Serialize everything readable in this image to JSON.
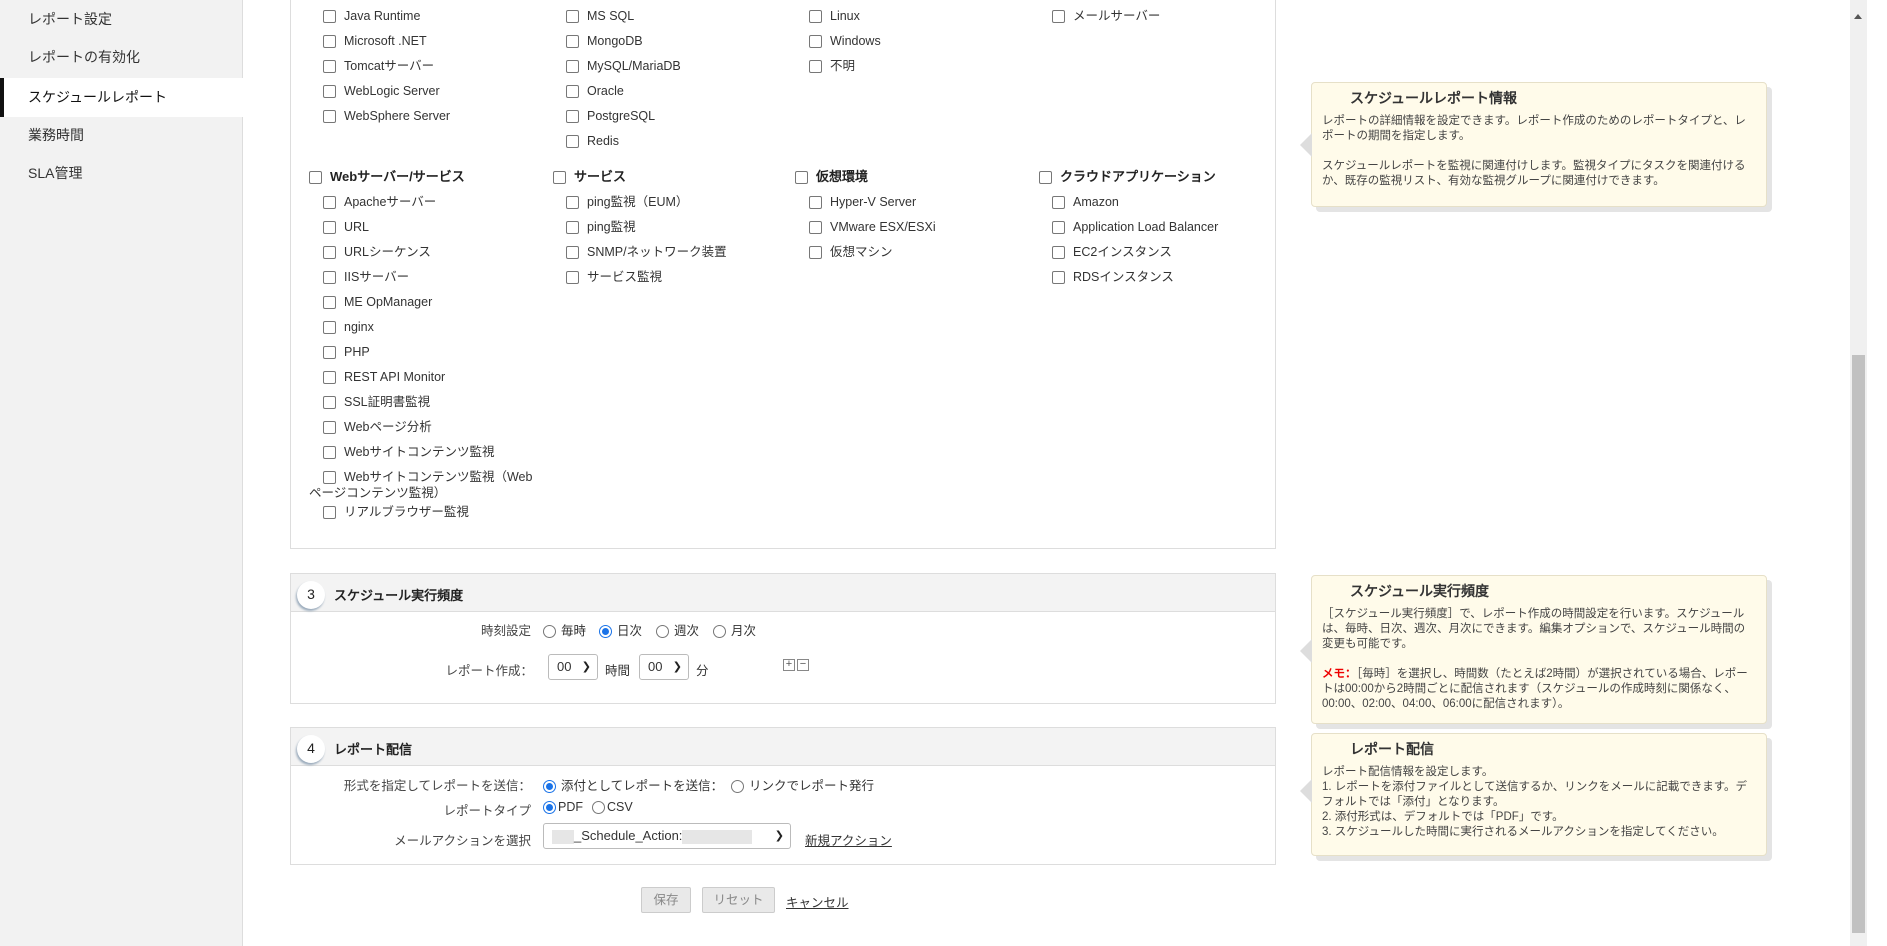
{
  "sidebar": {
    "items": [
      {
        "label": "レポート設定"
      },
      {
        "label": "レポートの有効化"
      },
      {
        "label": "スケジュールレポート",
        "active": true
      },
      {
        "label": "業務時間"
      },
      {
        "label": "SLA管理"
      }
    ]
  },
  "monitors": {
    "top_columns": [
      [
        "Java Runtime",
        "Microsoft .NET",
        "Tomcatサーバー",
        "WebLogic Server",
        "WebSphere Server"
      ],
      [
        "MS SQL",
        "MongoDB",
        "MySQL/MariaDB",
        "Oracle",
        "PostgreSQL",
        "Redis"
      ],
      [
        "Linux",
        "Windows",
        "不明"
      ],
      [
        "メールサーバー"
      ]
    ],
    "groups": [
      {
        "title": "Webサーバー/サービス",
        "items": [
          "Apacheサーバー",
          "URL",
          "URLシーケンス",
          "IISサーバー",
          "ME OpManager",
          "nginx",
          "PHP",
          "REST API Monitor",
          "SSL証明書監視",
          "Webページ分析",
          "Webサイトコンテンツ監視",
          "Webサイトコンテンツ監視（Webページコンテンツ監視）",
          "リアルブラウザー監視"
        ]
      },
      {
        "title": "サービス",
        "items": [
          "ping監視（EUM）",
          "ping監視",
          "SNMP/ネットワーク装置",
          "サービス監視"
        ]
      },
      {
        "title": "仮想環境",
        "items": [
          "Hyper-V Server",
          "VMware ESX/ESXi",
          "仮想マシン"
        ]
      },
      {
        "title": "クラウドアプリケーション",
        "items": [
          "Amazon",
          "Application Load Balancer",
          "EC2インスタンス",
          "RDSインスタンス"
        ]
      }
    ]
  },
  "schedule": {
    "number": "3",
    "title": "スケジュール実行頻度",
    "time_label": "時刻設定",
    "options": [
      "毎時",
      "日次",
      "週次",
      "月次"
    ],
    "selected": "日次",
    "create_label": "レポート作成：",
    "hour_value": "00",
    "hour_unit": "時間",
    "minute_value": "00",
    "minute_unit": "分"
  },
  "delivery": {
    "number": "4",
    "title": "レポート配信",
    "format_label": "形式を指定してレポートを送信：",
    "attach_option": "添付としてレポートを送信：",
    "link_option": "リンクでレポート発行",
    "type_label": "レポートタイプ",
    "pdf": "PDF",
    "csv": "CSV",
    "action_label": "メールアクションを選択",
    "action_value": "_Schedule_Action:",
    "new_action": "新規アクション"
  },
  "buttons": {
    "save": "保存",
    "reset": "リセット",
    "cancel": "キャンセル"
  },
  "info": {
    "report": {
      "title": "スケジュールレポート情報",
      "p1": "レポートの詳細情報を設定できます。レポート作成のためのレポートタイプと、レポートの期間を指定します。",
      "p2": "スケジュールレポートを監視に関連付けします。監視タイプにタスクを関連付けるか、既存の監視リスト、有効な監視グループに関連付けできます。"
    },
    "frequency": {
      "title": "スケジュール実行頻度",
      "p1": "［スケジュール実行頻度］で、レポート作成の時間設定を行います。スケジュールは、毎時、日次、週次、月次にできます。編集オプションで、スケジュール時間の変更も可能です。",
      "memo_label": "メモ：",
      "memo": "［毎時］を選択し、時間数（たとえば2時間）が選択されている場合、レポートは00:00から2時間ごとに配信されます（スケジュールの作成時刻に関係なく、00:00、02:00、04:00、06:00に配信されます）。"
    },
    "delivery": {
      "title": "レポート配信",
      "lines": [
        "レポート配信情報を設定します。",
        "1.  レポートを添付ファイルとして送信するか、リンクをメールに記載できます。デフォルトでは「添付」となります。",
        "2.  添付形式は、デフォルトでは「PDF」です。",
        "3.  スケジュールした時間に実行されるメールアクションを指定してください。"
      ]
    }
  },
  "colors": {
    "accent": "#1a73e8",
    "memo": "#ee0000",
    "info_bg": "#fffbea"
  }
}
